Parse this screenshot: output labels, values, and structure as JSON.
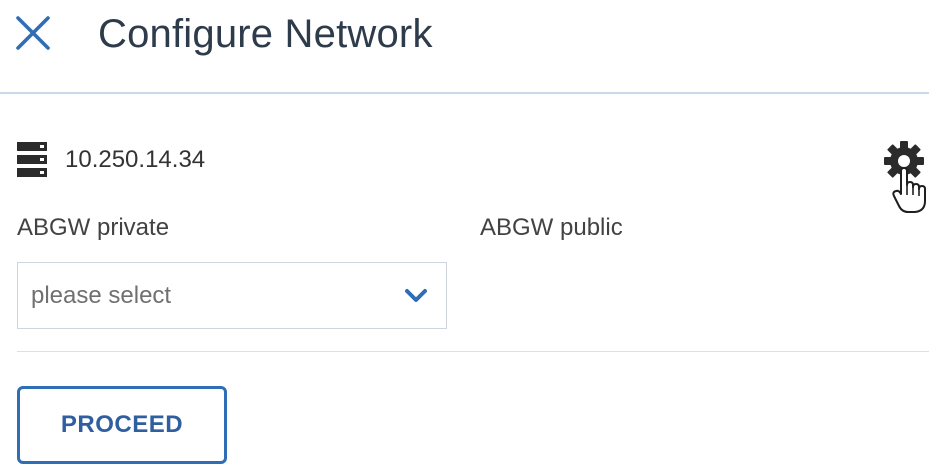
{
  "header": {
    "title": "Configure Network",
    "close_icon": "close-icon"
  },
  "node": {
    "icon": "server-icon",
    "ip": "10.250.14.34",
    "settings_icon": "gear-icon"
  },
  "columns": {
    "private_label": "ABGW private",
    "public_label": "ABGW public"
  },
  "private_select": {
    "placeholder": "please select",
    "icon": "chevron-down-icon"
  },
  "actions": {
    "proceed_label": "PROCEED"
  },
  "colors": {
    "accent": "#2f6db5",
    "header_divider": "#c9d8ea",
    "title_text": "#2d3b4a"
  }
}
